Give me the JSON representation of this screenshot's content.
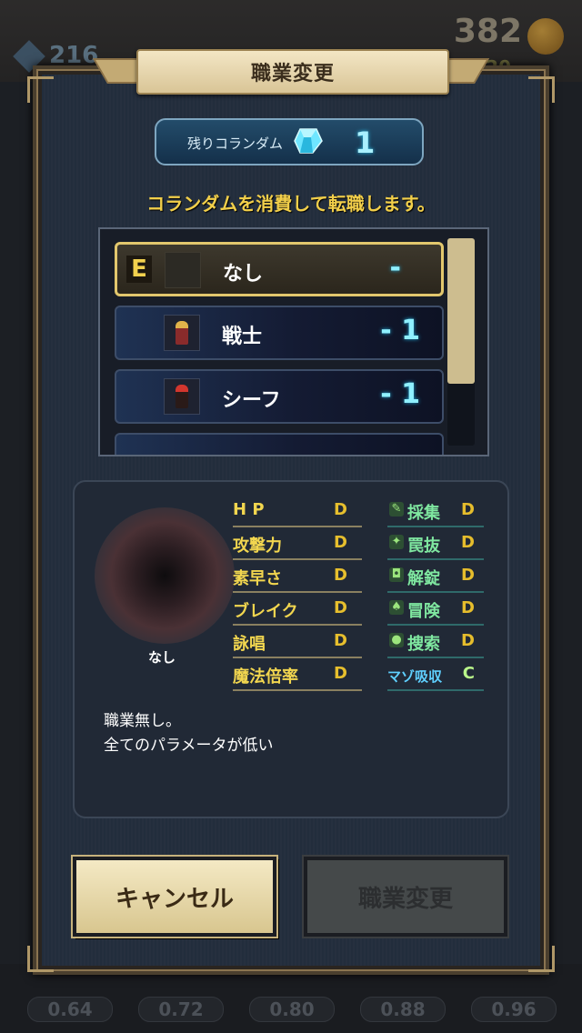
{
  "background": {
    "crystal_count": "216",
    "gold": "382",
    "small_count": "20",
    "zoom_pills": [
      "0.64",
      "0.72",
      "0.80",
      "0.88",
      "0.96"
    ]
  },
  "dialog": {
    "title": "職業変更",
    "corundum_label": "残りコランダム",
    "corundum_count": "1",
    "instruction": "コランダムを消費して転職します。"
  },
  "jobs": [
    {
      "badge": "E",
      "name": "なし",
      "cost": "-"
    },
    {
      "name": "戦士",
      "cost": "- 1"
    },
    {
      "name": "シーフ",
      "cost": "- 1"
    }
  ],
  "detail": {
    "portrait_name": "なし",
    "stats": [
      {
        "label": "H P",
        "grade": "D"
      },
      {
        "label": "攻撃力",
        "grade": "D"
      },
      {
        "label": "素早さ",
        "grade": "D"
      },
      {
        "label": "ブレイク",
        "grade": "D"
      },
      {
        "label": "詠唱",
        "grade": "D"
      },
      {
        "label": "魔法倍率",
        "grade": "D"
      }
    ],
    "skills": [
      {
        "label": "採集",
        "grade": "D"
      },
      {
        "label": "罠抜",
        "grade": "D"
      },
      {
        "label": "解錠",
        "grade": "D"
      },
      {
        "label": "冒険",
        "grade": "D"
      },
      {
        "label": "捜索",
        "grade": "D"
      },
      {
        "label": "マゾ吸収",
        "grade": "C"
      }
    ],
    "description_line1": "職業無し。",
    "description_line2": "全てのパラメータが低い"
  },
  "buttons": {
    "cancel": "キャンセル",
    "change": "職業変更"
  },
  "colors": {
    "accent_gold": "#f2cf4a",
    "grade": "#e7bf2d",
    "skill_green": "#7fe7a0",
    "cyan": "#8ff0ff"
  }
}
